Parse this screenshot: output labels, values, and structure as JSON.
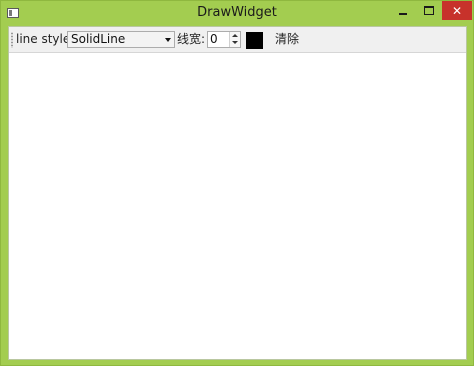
{
  "window": {
    "title": "DrawWidget",
    "icons": {
      "app": "app-window-icon",
      "minimize": "minimize-icon",
      "maximize": "maximize-icon",
      "close": "close-icon"
    },
    "colors": {
      "frame": "#a3cd50",
      "close_button": "#c7322b"
    }
  },
  "toolbar": {
    "line_style_label": "line style",
    "line_style_value": "SolidLine",
    "line_width_label": "线宽:",
    "line_width_value": "0",
    "color_value": "#000000",
    "clear_label": "清除"
  }
}
